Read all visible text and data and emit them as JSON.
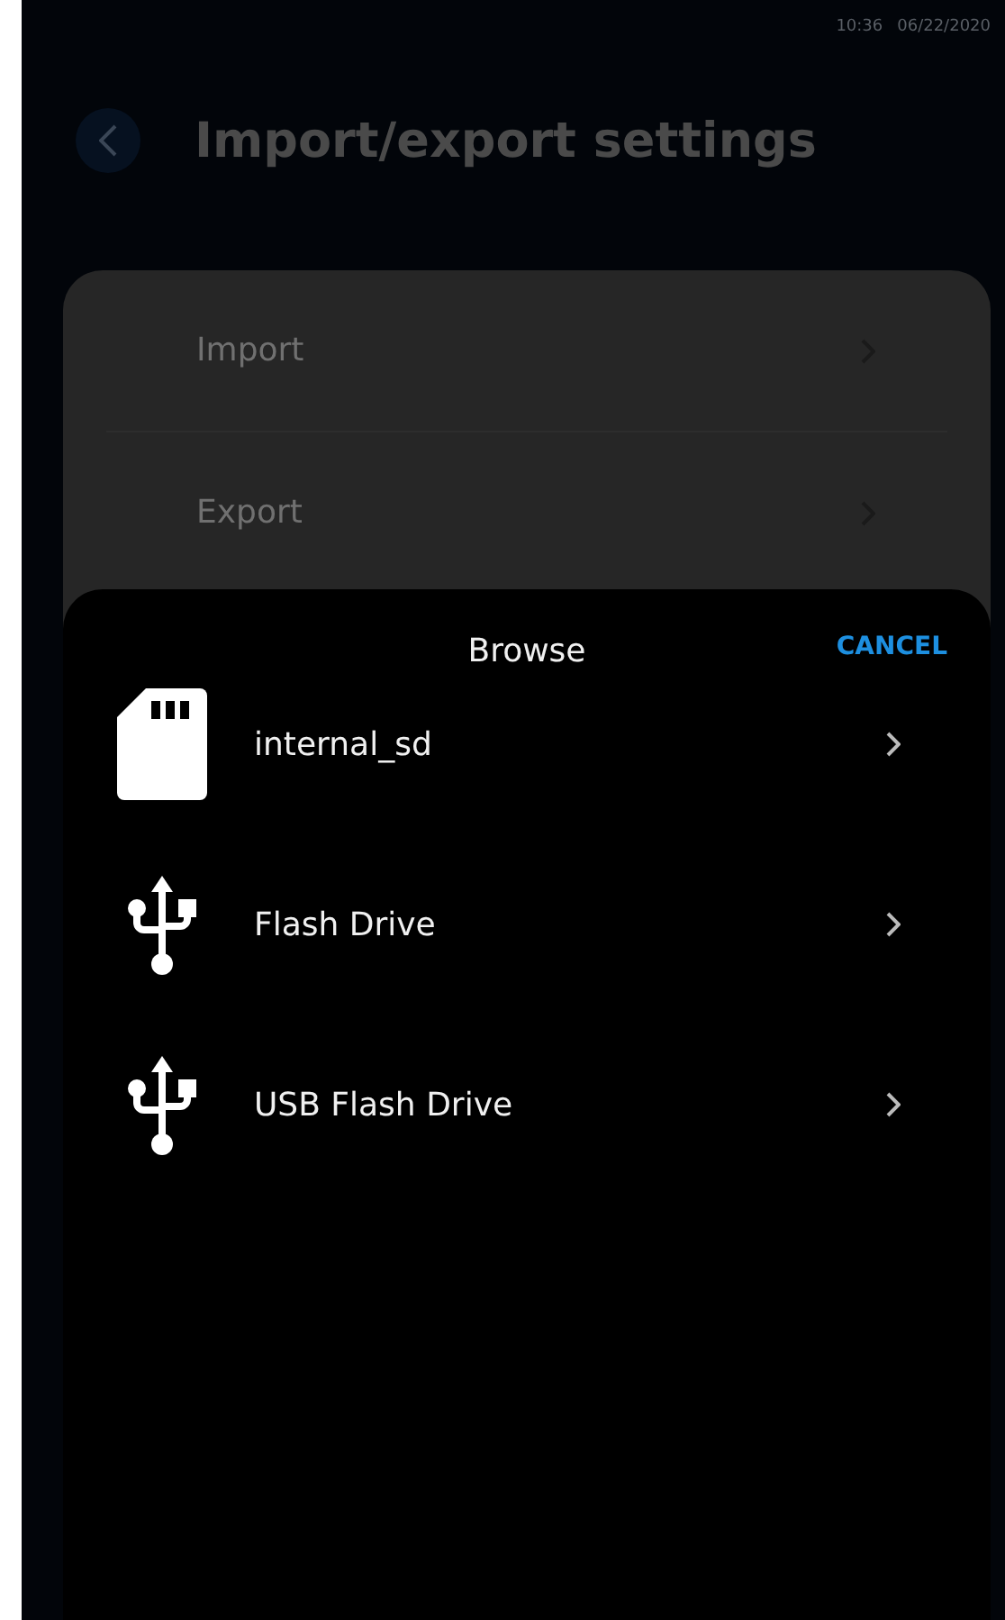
{
  "status_bar": {
    "time": "10:36",
    "date": "06/22/2020"
  },
  "header": {
    "title": "Import/export settings"
  },
  "settings": [
    {
      "label": "Import"
    },
    {
      "label": "Export"
    }
  ],
  "sheet": {
    "title": "Browse",
    "cancel": "CANCEL",
    "items": [
      {
        "kind": "sd",
        "label": "internal_sd"
      },
      {
        "kind": "usb",
        "label": "Flash Drive"
      },
      {
        "kind": "usb",
        "label": "USB Flash Drive"
      }
    ]
  }
}
